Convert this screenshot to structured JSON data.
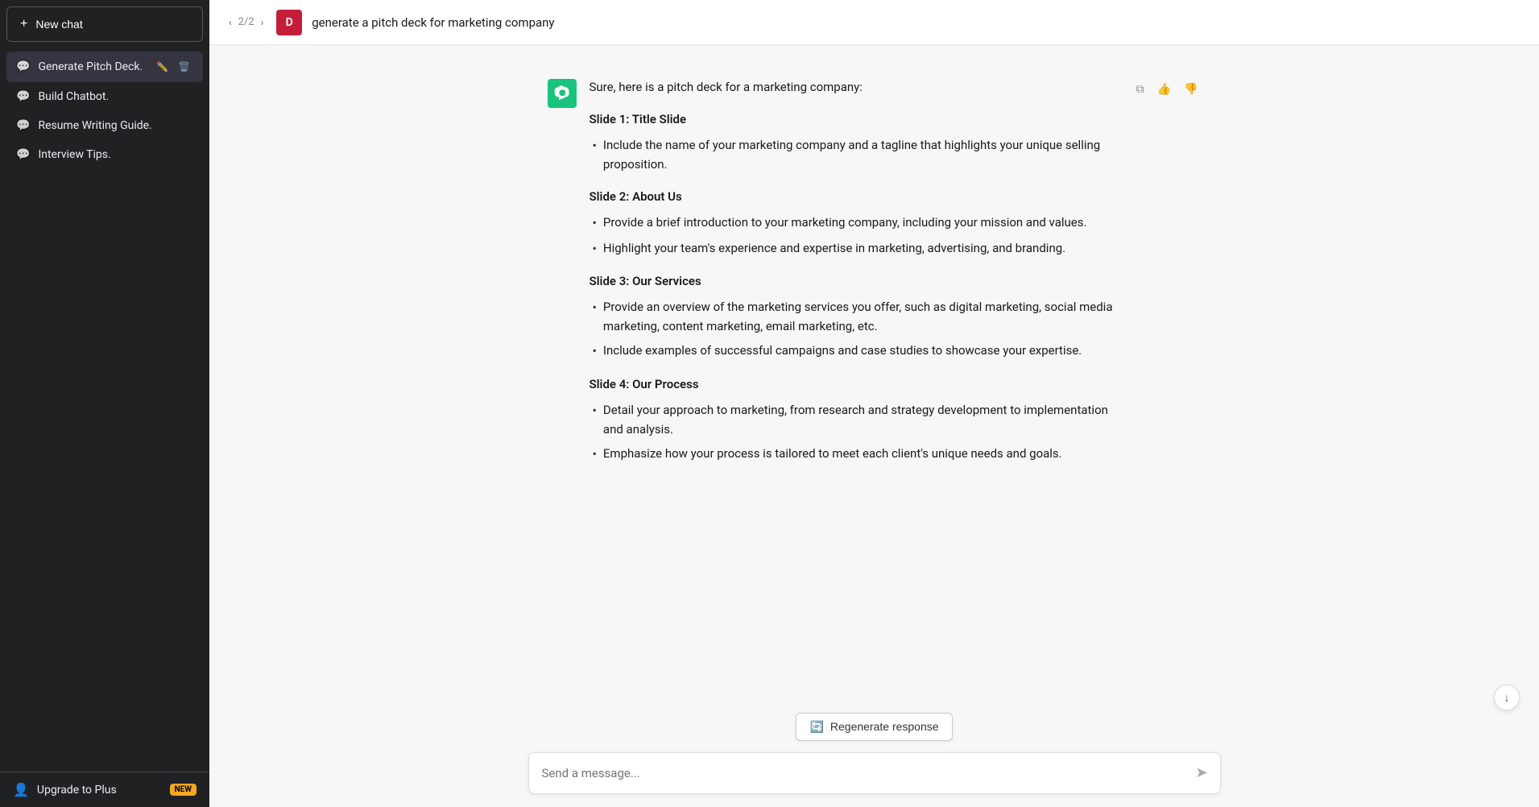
{
  "sidebar": {
    "new_chat_label": "New chat",
    "items": [
      {
        "id": "generate-pitch-deck",
        "label": "Generate Pitch Deck.",
        "active": true
      },
      {
        "id": "build-chatbot",
        "label": "Build Chatbot.",
        "active": false
      },
      {
        "id": "resume-writing-guide",
        "label": "Resume Writing Guide.",
        "active": false
      },
      {
        "id": "interview-tips",
        "label": "Interview Tips.",
        "active": false
      }
    ],
    "footer": {
      "upgrade_label": "Upgrade to Plus",
      "badge_label": "NEW"
    }
  },
  "header": {
    "page_current": "2",
    "page_total": "2",
    "user_initial": "D",
    "title": "generate a pitch deck for marketing company"
  },
  "chat": {
    "intro": "Sure, here is a pitch deck for a marketing company:",
    "slides": [
      {
        "title": "Slide 1: Title Slide",
        "bullets": [
          "Include the name of your marketing company and a tagline that highlights your unique selling proposition."
        ]
      },
      {
        "title": "Slide 2: About Us",
        "bullets": [
          "Provide a brief introduction to your marketing company, including your mission and values.",
          "Highlight your team's experience and expertise in marketing, advertising, and branding."
        ]
      },
      {
        "title": "Slide 3: Our Services",
        "bullets": [
          "Provide an overview of the marketing services you offer, such as digital marketing, social media marketing, content marketing, email marketing, etc.",
          "Include examples of successful campaigns and case studies to showcase your expertise."
        ]
      },
      {
        "title": "Slide 4: Our Process",
        "bullets": [
          "Detail your approach to marketing, from research and strategy development to implementation and analysis.",
          "Emphasize how your process is tailored to meet each client's unique needs and goals."
        ]
      }
    ]
  },
  "actions": {
    "copy_icon": "⧉",
    "thumbup_icon": "👍",
    "thumbdown_icon": "👎",
    "regenerate_label": "Regenerate response",
    "scroll_down_icon": "↓",
    "send_icon": "➤"
  },
  "input": {
    "placeholder": "Send a message..."
  }
}
